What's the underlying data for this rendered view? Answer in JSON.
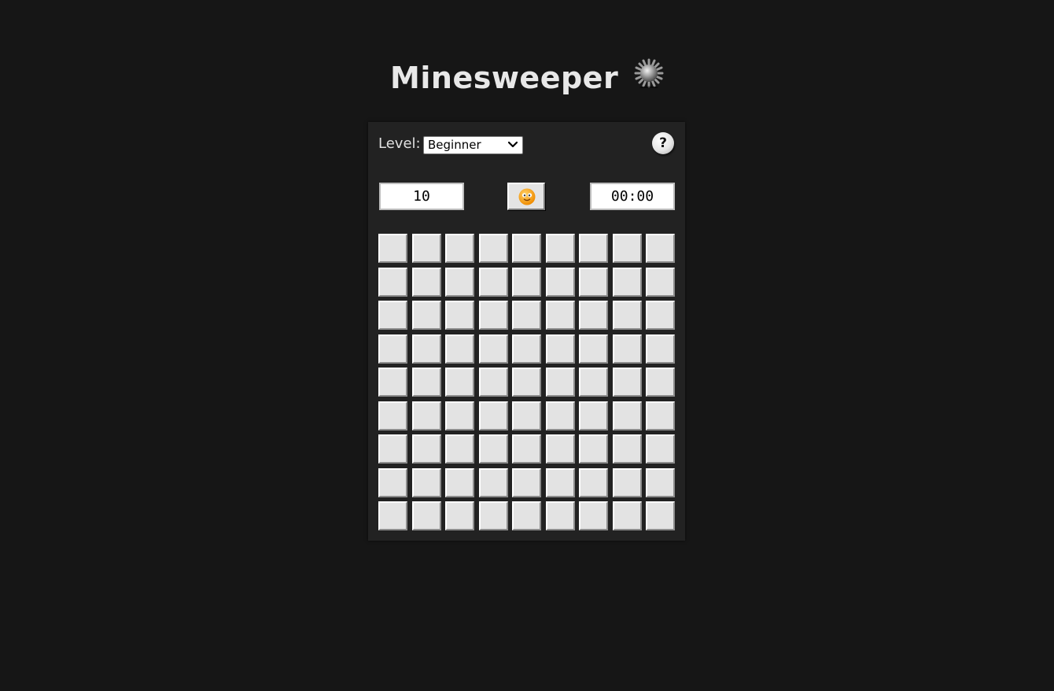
{
  "app": {
    "title": "Minesweeper",
    "title_icon": "mine-icon"
  },
  "controls": {
    "level_label": "Level:",
    "level_selected": "Beginner",
    "help_label": "?",
    "mines_remaining": "10",
    "timer": "00:00",
    "reset_icon": "smiley-face-icon"
  },
  "board": {
    "rows": 9,
    "columns": 9,
    "cell_state": "unrevealed"
  },
  "colors": {
    "background": "#161616",
    "panel": "#222222",
    "cell": "#e3e3e3",
    "smiley": "#f5a623"
  }
}
